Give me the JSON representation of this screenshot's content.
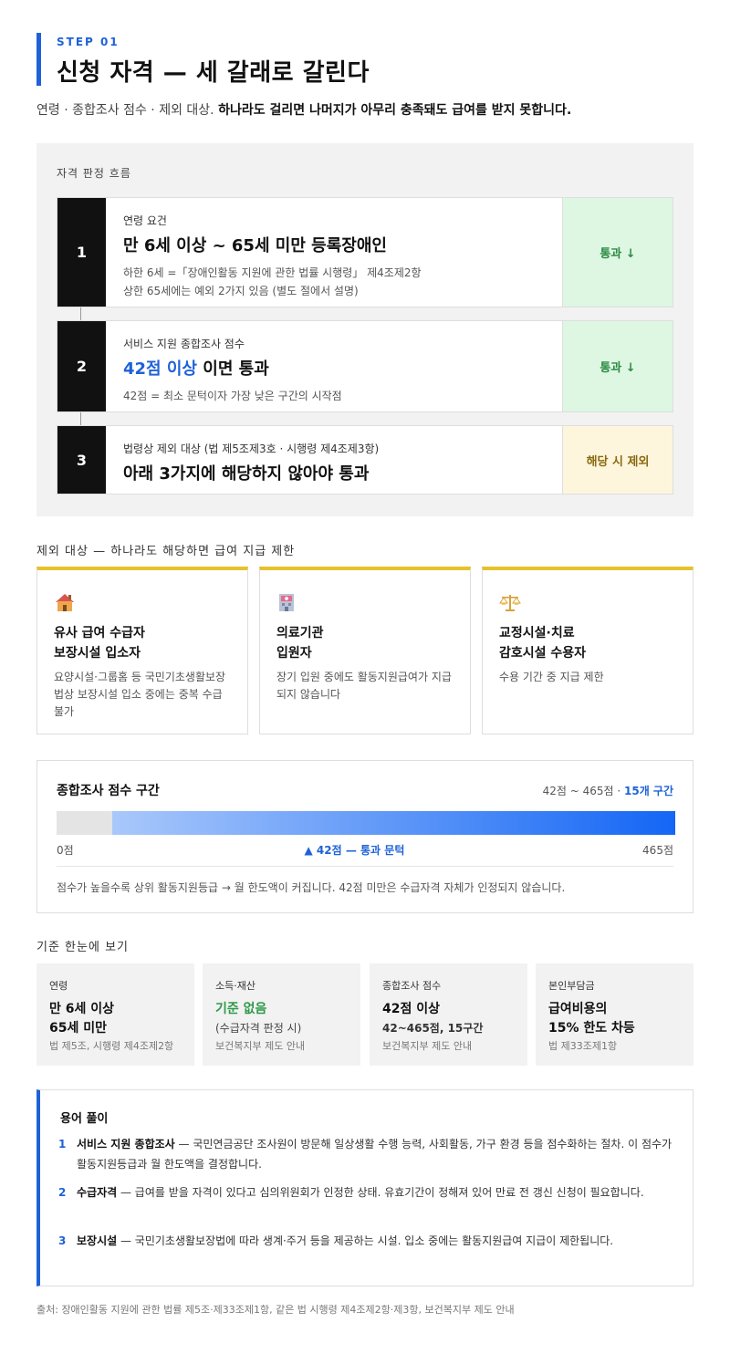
{
  "header": {
    "step": "STEP 01",
    "title": "신청 자격 — 세 갈래로 갈린다",
    "lead_plain": "연령 · 종합조사 점수 · 제외 대상. ",
    "lead_bold": "하나라도 걸리면 나머지가 아무리 충족돼도 급여를 받지 못합니다."
  },
  "flow": {
    "caption": "자격 판정 흐름",
    "steps": [
      {
        "num": "1",
        "sub": "연령 요건",
        "main_a": "만 6세 이상  ~  65세 미만 등록장애인",
        "note1": "하한 6세 =「장애인활동 지원에 관한 법률 시행령」 제4조제2항",
        "note2": "상한 65세에는 예외 2가지 있음 (별도 절에서 설명)",
        "status": "통과 ↓"
      },
      {
        "num": "2",
        "sub": "서비스 지원 종합조사 점수",
        "main_hl": "42점 이상",
        "main_b": " 이면 통과",
        "note1": "42점 = 최소 문턱이자 가장 낮은 구간의 시작점",
        "status": "통과 ↓"
      },
      {
        "num": "3",
        "sub": "법령상 제외 대상 (법 제5조제3호 · 시행령 제4조제3항)",
        "main_a": "아래 3가지에 해당하지 않아야 통과",
        "status": "해당 시 제외"
      }
    ]
  },
  "exclusions": {
    "label": "제외 대상 — 하나라도 해당하면 급여 지급 제한",
    "items": [
      {
        "icon": "house-icon",
        "title1": "유사 급여 수급자",
        "title2": "보장시설 입소자",
        "desc": "요양시설·그룹홈 등 국민기초생활보장법상 보장시설 입소 중에는 중복 수급 불가"
      },
      {
        "icon": "hospital-icon",
        "title1": "의료기관",
        "title2": "입원자",
        "desc": "장기 입원 중에도 활동지원급여가 지급되지 않습니다"
      },
      {
        "icon": "scales-icon",
        "title1": "교정시설·치료",
        "title2": "감호시설 수용자",
        "desc": "수용 기간 중 지급 제한"
      }
    ]
  },
  "score": {
    "title": "종합조사 점수 구간",
    "range_text": "42점 ~ 465점 · ",
    "range_bold": "15개 구간",
    "min_label": "0점",
    "max_label": "465점",
    "marker_label": "▲ 42점 — 통과 문턱",
    "note": "점수가 높을수록 상위 활동지원등급 → 월 한도액이 커집니다. 42점 미만은 수급자격 자체가 인정되지 않습니다.",
    "min": 0,
    "max": 465,
    "threshold": 42,
    "fill_color_start": "#a9c8fb",
    "fill_color_end": "#1466f5"
  },
  "summary": {
    "label": "기준 한눈에 보기",
    "cards": [
      {
        "label": "연령",
        "value1": "만 6세 이상",
        "value2": "65세 미만",
        "detail": "",
        "source": "법 제5조, 시행령 제4조제2항"
      },
      {
        "label": "소득·재산",
        "value1": "기준 없음",
        "value2": "",
        "detail": "(수급자격 판정 시)",
        "source": "보건복지부 제도 안내"
      },
      {
        "label": "종합조사 점수",
        "value1": "42점 이상",
        "value2": "",
        "detail": "42~465점, 15구간",
        "source": "보건복지부 제도 안내"
      },
      {
        "label": "본인부담금",
        "value1": "급여비용의",
        "value2": "15% 한도 차등",
        "detail": "",
        "source": "법 제33조제1항"
      }
    ]
  },
  "glossary": {
    "title": "용어 풀이",
    "items": [
      {
        "num": "1",
        "term": "서비스 지원 종합조사",
        "text": " — 국민연금공단 조사원이 방문해 일상생활 수행 능력, 사회활동, 가구 환경 등을 점수화하는 절차. 이 점수가 활동지원등급과 월 한도액을 결정합니다."
      },
      {
        "num": "2",
        "term": "수급자격",
        "text": " — 급여를 받을 자격이 있다고 심의위원회가 인정한 상태. 유효기간이 정해져 있어 만료 전 갱신 신청이 필요합니다."
      },
      {
        "num": "3",
        "term": "보장시설",
        "text": " — 국민기초생활보장법에 따라 생계·주거 등을 제공하는 시설. 입소 중에는 활동지원급여 지급이 제한됩니다."
      }
    ]
  },
  "source": "출처: 장애인활동 지원에 관한 법률 제5조·제33조제1항, 같은 법 시행령 제4조제2항·제3항, 보건복지부 제도 안내"
}
